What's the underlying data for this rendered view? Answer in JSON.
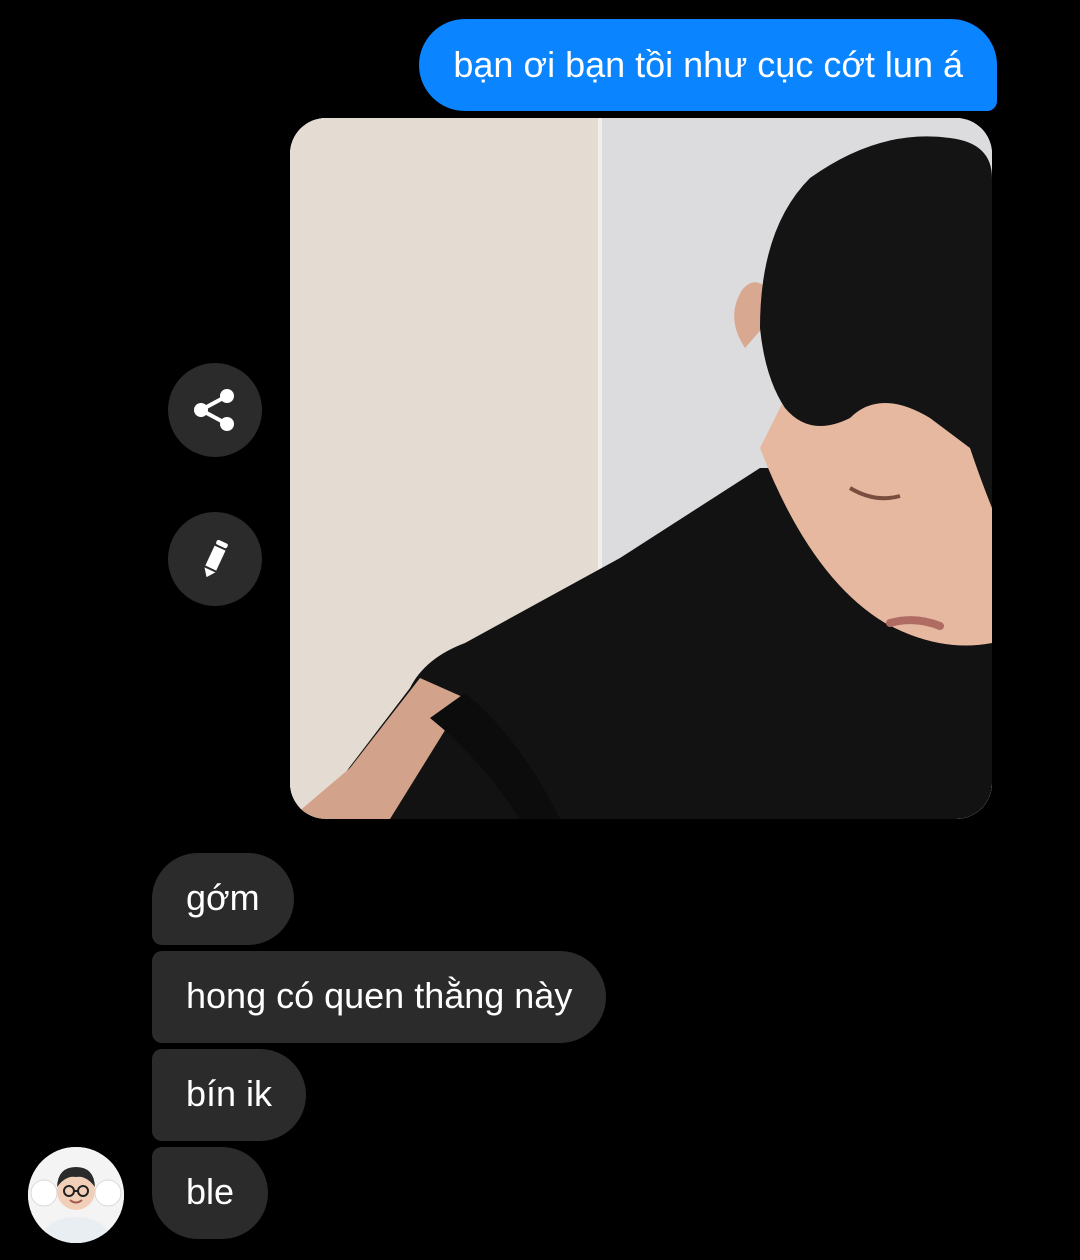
{
  "conversation": {
    "sent_message": "bạn ơi bạn tồi như cục cớt lun á",
    "received_messages": [
      "gớm",
      "hong có quen thằng này",
      "bín ik",
      "ble"
    ]
  },
  "actions": {
    "share_icon": "share-icon",
    "edit_icon": "pencil-icon"
  },
  "colors": {
    "background": "#000000",
    "sent_bubble": "#0a84ff",
    "received_bubble": "#2b2b2b",
    "text": "#ffffff"
  }
}
